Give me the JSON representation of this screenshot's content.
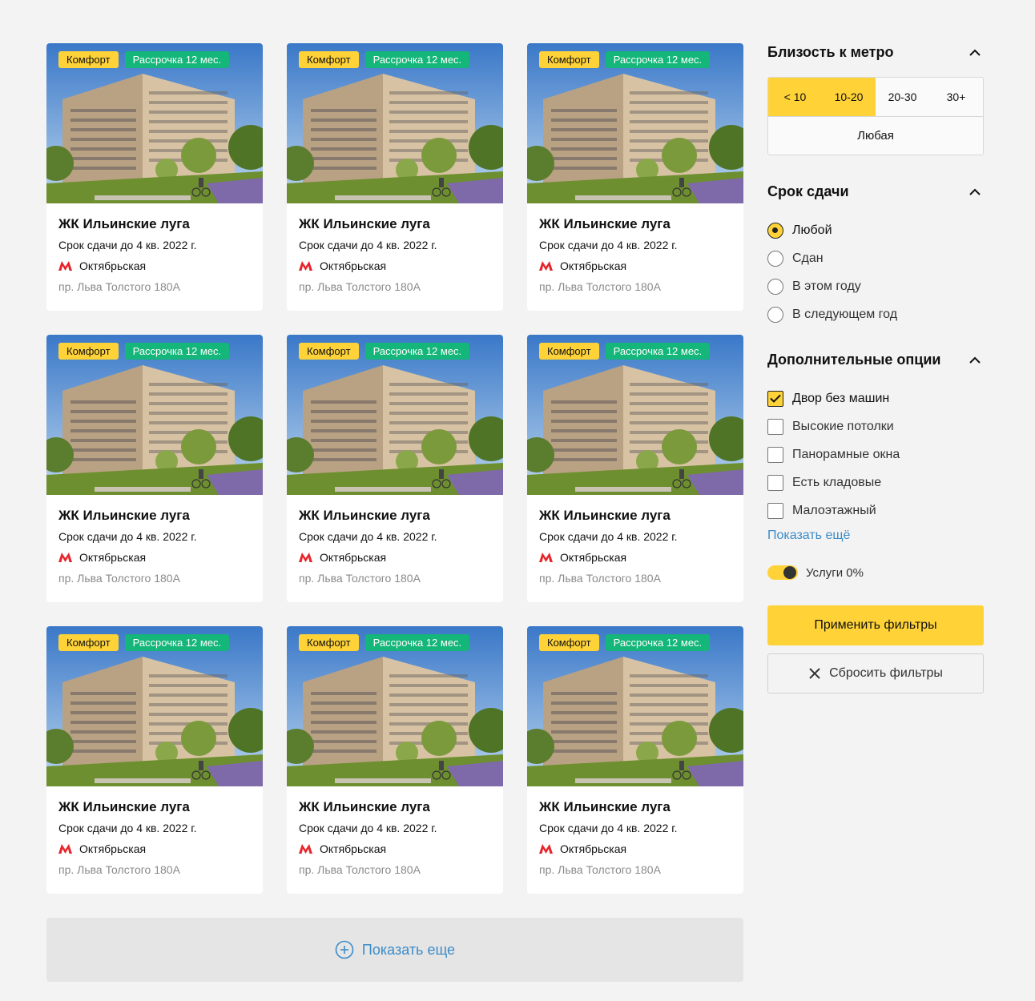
{
  "cards": [
    {
      "badge_class": "Комфорт",
      "badge_installment": "Рассрочка 12 мес.",
      "title": "ЖК Ильинские луга",
      "term": "Срок сдачи до 4 кв. 2022 г.",
      "metro": "Октябрьская",
      "address": "пр. Льва Толстого 180А"
    },
    {
      "badge_class": "Комфорт",
      "badge_installment": "Рассрочка 12 мес.",
      "title": "ЖК Ильинские луга",
      "term": "Срок сдачи до 4 кв. 2022 г.",
      "metro": "Октябрьская",
      "address": "пр. Льва Толстого 180А"
    },
    {
      "badge_class": "Комфорт",
      "badge_installment": "Рассрочка 12 мес.",
      "title": "ЖК Ильинские луга",
      "term": "Срок сдачи до 4 кв. 2022 г.",
      "metro": "Октябрьская",
      "address": "пр. Льва Толстого 180А"
    },
    {
      "badge_class": "Комфорт",
      "badge_installment": "Рассрочка 12 мес.",
      "title": "ЖК Ильинские луга",
      "term": "Срок сдачи до 4 кв. 2022 г.",
      "metro": "Октябрьская",
      "address": "пр. Льва Толстого 180А"
    },
    {
      "badge_class": "Комфорт",
      "badge_installment": "Рассрочка 12 мес.",
      "title": "ЖК Ильинские луга",
      "term": "Срок сдачи до 4 кв. 2022 г.",
      "metro": "Октябрьская",
      "address": "пр. Льва Толстого 180А"
    },
    {
      "badge_class": "Комфорт",
      "badge_installment": "Рассрочка 12 мес.",
      "title": "ЖК Ильинские луга",
      "term": "Срок сдачи до 4 кв. 2022 г.",
      "metro": "Октябрьская",
      "address": "пр. Льва Толстого 180А"
    },
    {
      "badge_class": "Комфорт",
      "badge_installment": "Рассрочка 12 мес.",
      "title": "ЖК Ильинские луга",
      "term": "Срок сдачи до 4 кв. 2022 г.",
      "metro": "Октябрьская",
      "address": "пр. Льва Толстого 180А"
    },
    {
      "badge_class": "Комфорт",
      "badge_installment": "Рассрочка 12 мес.",
      "title": "ЖК Ильинские луга",
      "term": "Срок сдачи до 4 кв. 2022 г.",
      "metro": "Октябрьская",
      "address": "пр. Льва Толстого 180А"
    },
    {
      "badge_class": "Комфорт",
      "badge_installment": "Рассрочка 12 мес.",
      "title": "ЖК Ильинские луга",
      "term": "Срок сдачи до 4 кв. 2022 г.",
      "metro": "Октябрьская",
      "address": "пр. Льва Толстого 180А"
    }
  ],
  "show_more_label": "Показать еще",
  "filters": {
    "metro": {
      "title": "Близость к метро",
      "options": [
        "< 10",
        "10-20",
        "20-30",
        "30+"
      ],
      "active": [
        "< 10",
        "10-20"
      ],
      "any_label": "Любая"
    },
    "term": {
      "title": "Срок сдачи",
      "options": [
        "Любой",
        "Сдан",
        "В этом году",
        "В следующем год"
      ],
      "selected": "Любой"
    },
    "extra": {
      "title": "Дополнительные опции",
      "options": [
        "Двор без машин",
        "Высокие потолки",
        "Панорамные окна",
        "Есть кладовые",
        "Малоэтажный"
      ],
      "checked": [
        "Двор без машин"
      ],
      "show_more": "Показать ещё"
    },
    "toggle_label": "Услуги 0%",
    "toggle_on": true,
    "apply_label": "Применить фильтры",
    "reset_label": "Сбросить фильтры"
  },
  "colors": {
    "accent": "#ffd338",
    "green": "#14b679",
    "link": "#3c8cc8",
    "metro": "#e8242b"
  },
  "icons": [
    "metro-icon",
    "chevron-up-icon",
    "check-icon",
    "close-icon",
    "plus-circle-icon"
  ]
}
